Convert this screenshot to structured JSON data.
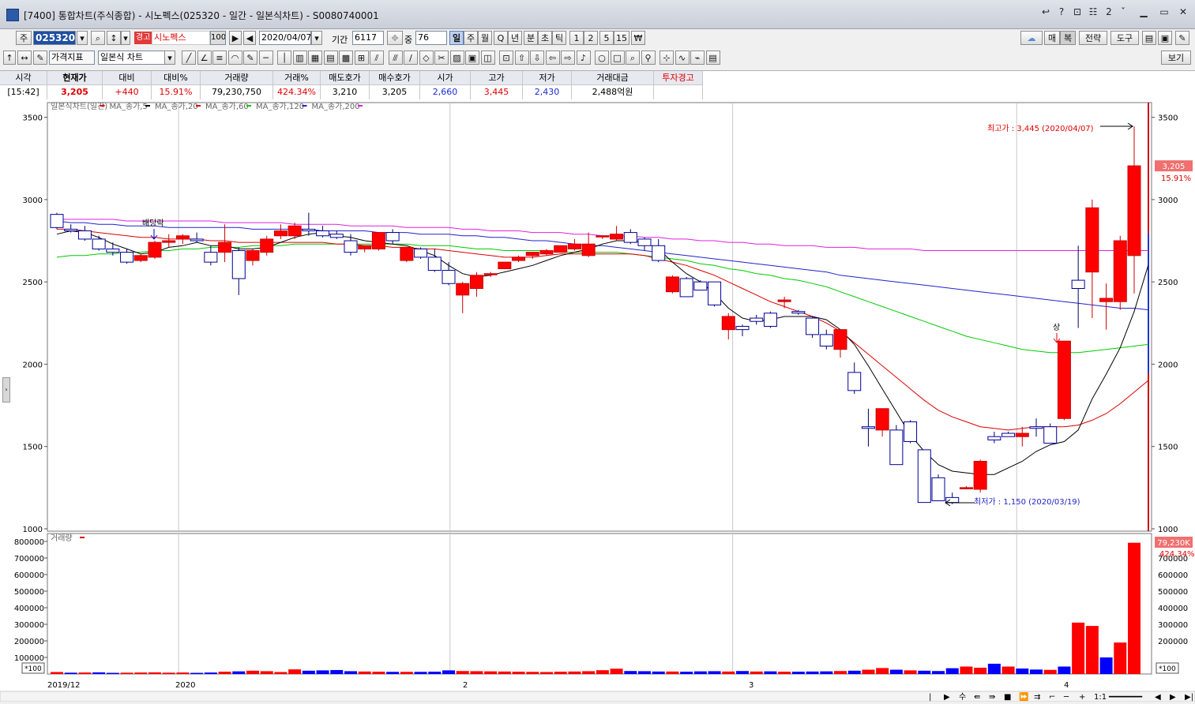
{
  "window": {
    "title": "[7400] 통합차트(주식종합) - 시노펙스(025320 - 일간 - 일본식차트) - S0080740001",
    "right_icons": [
      "↩",
      "?",
      "⊡",
      "☷",
      "2",
      "ˇ",
      "▁",
      "▭",
      "✕"
    ]
  },
  "toolbar1": {
    "market": "주",
    "code": "025320",
    "warning": "경고",
    "stock_name": "시노펙스",
    "percent_field": "100",
    "date": "2020/04/07",
    "period_label": "기간",
    "period_value": "6117",
    "count_label": "중",
    "count_value": "76",
    "period_buttons": [
      "일",
      "주",
      "월",
      "Q",
      "년",
      "분",
      "초",
      "틱",
      "1",
      "2",
      "5",
      "15",
      "₩"
    ],
    "active_period": "일",
    "right_buttons": [
      "매",
      "복",
      "전략",
      "도구"
    ]
  },
  "toolbar2": {
    "indicator_select": "가격지표",
    "chart_type_select": "일본식 차트",
    "view_button": "보기"
  },
  "quote": {
    "headers": [
      "시각",
      "현재가",
      "대비",
      "대비%",
      "거래량",
      "거래%",
      "매도호가",
      "매수호가",
      "시가",
      "고가",
      "저가",
      "거래대금",
      "투자경고"
    ],
    "values": [
      "[15:42]",
      "3,205",
      "+440",
      "15.91%",
      "79,230,750",
      "424.34%",
      "3,210",
      "3,205",
      "2,660",
      "3,445",
      "2,430",
      "2,488억원",
      ""
    ]
  },
  "chart_data": [
    {
      "type": "candlestick",
      "title": "",
      "legend": [
        "일본식차트(일간)",
        "MA_종가,5",
        "MA_종가,20",
        "MA_종가,60",
        "MA_종가,120",
        "MA_종가,200"
      ],
      "ylim": [
        1000,
        3600
      ],
      "y_ticks": [
        1000,
        1500,
        2000,
        2500,
        3000,
        3500
      ],
      "x_labels": [
        "2019/12",
        "2020",
        "2",
        "3",
        "4"
      ],
      "current_price": "3,205",
      "current_change": "15.91%",
      "annotations": {
        "high": "최고가 : 3,445 (2020/04/07)",
        "low": "최저가 : 1,150 (2020/03/19)",
        "dividend": "배당락",
        "limit_up": "상"
      },
      "candles": [
        [
          2910,
          2920,
          2820,
          2830
        ],
        [
          2820,
          2850,
          2800,
          2810
        ],
        [
          2810,
          2840,
          2750,
          2760
        ],
        [
          2760,
          2780,
          2690,
          2700
        ],
        [
          2700,
          2740,
          2660,
          2680
        ],
        [
          2680,
          2700,
          2610,
          2620
        ],
        [
          2630,
          2670,
          2620,
          2660
        ],
        [
          2650,
          2750,
          2640,
          2740
        ],
        [
          2740,
          2790,
          2710,
          2750
        ],
        [
          2760,
          2790,
          2730,
          2780
        ],
        [
          2760,
          2800,
          2740,
          2750
        ],
        [
          2680,
          2720,
          2600,
          2620
        ],
        [
          2680,
          2850,
          2620,
          2740
        ],
        [
          2690,
          2710,
          2420,
          2520
        ],
        [
          2630,
          2700,
          2600,
          2690
        ],
        [
          2680,
          2780,
          2660,
          2760
        ],
        [
          2780,
          2850,
          2760,
          2810
        ],
        [
          2780,
          2860,
          2760,
          2840
        ],
        [
          2820,
          2920,
          2780,
          2810
        ],
        [
          2810,
          2840,
          2770,
          2780
        ],
        [
          2790,
          2810,
          2760,
          2770
        ],
        [
          2750,
          2790,
          2660,
          2680
        ],
        [
          2700,
          2720,
          2680,
          2720
        ],
        [
          2700,
          2780,
          2690,
          2800
        ],
        [
          2800,
          2820,
          2730,
          2750
        ],
        [
          2630,
          2700,
          2620,
          2710
        ],
        [
          2700,
          2710,
          2640,
          2650
        ],
        [
          2650,
          2700,
          2560,
          2570
        ],
        [
          2570,
          2620,
          2480,
          2490
        ],
        [
          2420,
          2500,
          2310,
          2490
        ],
        [
          2460,
          2560,
          2410,
          2540
        ],
        [
          2550,
          2560,
          2530,
          2550
        ],
        [
          2580,
          2620,
          2580,
          2620
        ],
        [
          2630,
          2660,
          2620,
          2650
        ],
        [
          2660,
          2680,
          2640,
          2680
        ],
        [
          2670,
          2700,
          2660,
          2690
        ],
        [
          2680,
          2720,
          2680,
          2720
        ],
        [
          2700,
          2760,
          2690,
          2730
        ],
        [
          2660,
          2800,
          2650,
          2730
        ],
        [
          2780,
          2780,
          2760,
          2780
        ],
        [
          2760,
          2840,
          2750,
          2790
        ],
        [
          2800,
          2820,
          2730,
          2740
        ],
        [
          2760,
          2770,
          2690,
          2720
        ],
        [
          2720,
          2760,
          2620,
          2630
        ],
        [
          2440,
          2540,
          2430,
          2530
        ],
        [
          2520,
          2530,
          2410,
          2410
        ],
        [
          2500,
          2510,
          2450,
          2450
        ],
        [
          2500,
          2500,
          2350,
          2360
        ],
        [
          2210,
          2310,
          2150,
          2290
        ],
        [
          2230,
          2240,
          2170,
          2210
        ],
        [
          2280,
          2300,
          2240,
          2260
        ],
        [
          2310,
          2320,
          2220,
          2230
        ],
        [
          2380,
          2410,
          2340,
          2390
        ],
        [
          2320,
          2330,
          2300,
          2310
        ],
        [
          2280,
          2290,
          2160,
          2180
        ],
        [
          2180,
          2210,
          2090,
          2110
        ],
        [
          2090,
          2200,
          2040,
          2210
        ],
        [
          1950,
          2010,
          1820,
          1840
        ],
        [
          1620,
          1730,
          1500,
          1610
        ],
        [
          1600,
          1710,
          1560,
          1730
        ],
        [
          1600,
          1630,
          1390,
          1390
        ],
        [
          1650,
          1660,
          1520,
          1530
        ],
        [
          1480,
          1480,
          1160,
          1160
        ],
        [
          1310,
          1330,
          1170,
          1170
        ],
        [
          1190,
          1220,
          1150,
          1160
        ],
        [
          1250,
          1260,
          1240,
          1250
        ],
        [
          1240,
          1420,
          1220,
          1410
        ],
        [
          1560,
          1590,
          1520,
          1540
        ],
        [
          1580,
          1590,
          1570,
          1560
        ],
        [
          1560,
          1620,
          1500,
          1580
        ],
        [
          1620,
          1670,
          1560,
          1610
        ],
        [
          1620,
          1640,
          1520,
          1520
        ],
        [
          1670,
          2140,
          1660,
          2140
        ],
        [
          2510,
          2720,
          2220,
          2460
        ],
        [
          2560,
          3000,
          2280,
          2950
        ],
        [
          2380,
          2490,
          2210,
          2400
        ],
        [
          2380,
          2780,
          2330,
          2750
        ],
        [
          2660,
          3445,
          2430,
          3205
        ]
      ],
      "ma5": [
        2790,
        2810,
        2800,
        2770,
        2730,
        2700,
        2670,
        2680,
        2710,
        2720,
        2740,
        2720,
        2720,
        2700,
        2700,
        2710,
        2740,
        2770,
        2790,
        2800,
        2780,
        2770,
        2750,
        2740,
        2730,
        2720,
        2690,
        2660,
        2600,
        2550,
        2530,
        2540,
        2560,
        2580,
        2600,
        2630,
        2660,
        2680,
        2700,
        2730,
        2750,
        2750,
        2740,
        2700,
        2620,
        2550,
        2500,
        2430,
        2340,
        2280,
        2260,
        2270,
        2290,
        2290,
        2290,
        2270,
        2210,
        2120,
        1990,
        1850,
        1710,
        1570,
        1470,
        1390,
        1350,
        1340,
        1330,
        1330,
        1370,
        1410,
        1470,
        1510,
        1530,
        1600,
        1790,
        1940,
        2100,
        2320,
        2600
      ],
      "ma20": [
        2820,
        2820,
        2810,
        2800,
        2790,
        2780,
        2770,
        2770,
        2760,
        2760,
        2760,
        2750,
        2750,
        2740,
        2740,
        2740,
        2740,
        2740,
        2740,
        2740,
        2730,
        2730,
        2720,
        2720,
        2710,
        2710,
        2700,
        2700,
        2690,
        2680,
        2670,
        2660,
        2650,
        2650,
        2650,
        2660,
        2670,
        2670,
        2670,
        2670,
        2670,
        2670,
        2660,
        2640,
        2620,
        2600,
        2570,
        2540,
        2500,
        2460,
        2420,
        2380,
        2350,
        2320,
        2290,
        2250,
        2200,
        2130,
        2060,
        1990,
        1920,
        1850,
        1780,
        1720,
        1680,
        1650,
        1620,
        1610,
        1600,
        1610,
        1620,
        1620,
        1620,
        1630,
        1660,
        1700,
        1760,
        1830,
        1900
      ],
      "ma60": [
        2650,
        2660,
        2660,
        2670,
        2670,
        2680,
        2680,
        2690,
        2690,
        2700,
        2700,
        2710,
        2710,
        2710,
        2720,
        2720,
        2720,
        2730,
        2730,
        2730,
        2730,
        2730,
        2730,
        2730,
        2730,
        2730,
        2720,
        2720,
        2720,
        2710,
        2700,
        2700,
        2690,
        2690,
        2690,
        2690,
        2680,
        2680,
        2680,
        2680,
        2680,
        2670,
        2660,
        2650,
        2640,
        2630,
        2610,
        2600,
        2580,
        2570,
        2550,
        2540,
        2520,
        2510,
        2490,
        2470,
        2440,
        2410,
        2380,
        2350,
        2320,
        2290,
        2260,
        2230,
        2200,
        2170,
        2150,
        2130,
        2110,
        2090,
        2080,
        2070,
        2070,
        2070,
        2080,
        2090,
        2100,
        2110,
        2120
      ],
      "ma120": [
        2870,
        2860,
        2860,
        2850,
        2850,
        2840,
        2840,
        2840,
        2830,
        2830,
        2830,
        2830,
        2830,
        2830,
        2820,
        2820,
        2820,
        2820,
        2820,
        2810,
        2810,
        2810,
        2810,
        2800,
        2800,
        2800,
        2790,
        2790,
        2790,
        2780,
        2780,
        2770,
        2770,
        2760,
        2750,
        2750,
        2740,
        2730,
        2720,
        2720,
        2710,
        2700,
        2690,
        2680,
        2670,
        2660,
        2650,
        2640,
        2630,
        2620,
        2610,
        2600,
        2590,
        2580,
        2570,
        2560,
        2540,
        2530,
        2520,
        2510,
        2500,
        2490,
        2480,
        2470,
        2460,
        2450,
        2440,
        2430,
        2420,
        2410,
        2400,
        2390,
        2380,
        2370,
        2360,
        2350,
        2340,
        2340,
        2330
      ],
      "ma200": [
        2880,
        2880,
        2880,
        2880,
        2880,
        2870,
        2870,
        2870,
        2870,
        2870,
        2870,
        2870,
        2860,
        2860,
        2860,
        2860,
        2860,
        2850,
        2850,
        2850,
        2850,
        2840,
        2840,
        2840,
        2840,
        2830,
        2830,
        2830,
        2830,
        2820,
        2820,
        2810,
        2810,
        2810,
        2800,
        2800,
        2800,
        2790,
        2790,
        2780,
        2780,
        2780,
        2770,
        2770,
        2760,
        2760,
        2750,
        2750,
        2740,
        2740,
        2730,
        2730,
        2720,
        2720,
        2720,
        2710,
        2710,
        2710,
        2700,
        2700,
        2700,
        2700,
        2690,
        2690,
        2690,
        2690,
        2690,
        2690,
        2690,
        2690,
        2690,
        2690,
        2690,
        2690,
        2690,
        2690,
        2690,
        2690,
        2690
      ]
    },
    {
      "type": "bar",
      "title": "",
      "legend": [
        "거래량"
      ],
      "ylim": [
        0,
        850000
      ],
      "y_ticks": [
        100000,
        200000,
        300000,
        400000,
        500000,
        600000,
        700000,
        800000
      ],
      "unit": "*100",
      "current_volume": "79,230K",
      "current_change": "424.34%",
      "values": [
        12000,
        8000,
        9000,
        10000,
        7000,
        8000,
        9000,
        10000,
        8000,
        9000,
        7000,
        9000,
        14000,
        16000,
        20000,
        17000,
        12000,
        28000,
        20000,
        22000,
        24000,
        17000,
        15000,
        14000,
        13000,
        13000,
        13000,
        14000,
        22000,
        18000,
        17000,
        16000,
        15000,
        14000,
        13000,
        12000,
        14000,
        15000,
        17000,
        23000,
        32000,
        18000,
        17000,
        15000,
        15000,
        14000,
        16000,
        17000,
        15000,
        18000,
        15000,
        16000,
        14000,
        14000,
        15000,
        16000,
        18000,
        20000,
        26000,
        36000,
        26000,
        22000,
        20000,
        18000,
        35000,
        45000,
        38000,
        62000,
        45000,
        33000,
        27000,
        25000,
        45000,
        310000,
        290000,
        100000,
        190000,
        792000
      ],
      "up": [
        true,
        false,
        true,
        false,
        false,
        true,
        true,
        true,
        true,
        true,
        false,
        false,
        true,
        false,
        true,
        true,
        true,
        true,
        false,
        false,
        false,
        false,
        true,
        true,
        false,
        true,
        false,
        false,
        false,
        true,
        true,
        true,
        true,
        true,
        true,
        true,
        true,
        true,
        true,
        true,
        true,
        false,
        false,
        false,
        true,
        false,
        false,
        false,
        true,
        false,
        true,
        false,
        true,
        false,
        false,
        false,
        true,
        false,
        true,
        true,
        false,
        true,
        false,
        false,
        false,
        true,
        true,
        false,
        true,
        false,
        false,
        true,
        false,
        true,
        true,
        false,
        true,
        true
      ]
    }
  ]
}
